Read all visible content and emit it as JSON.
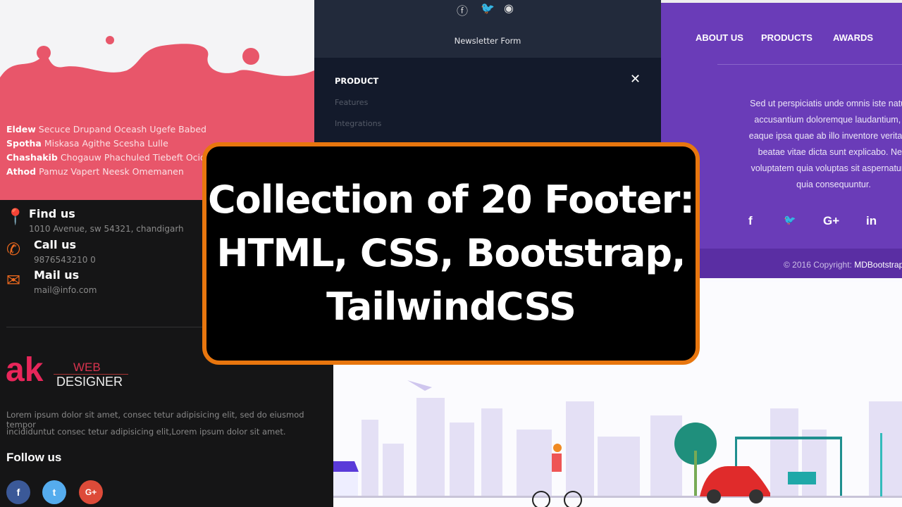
{
  "title_lines": [
    "Collection of 20 Footer:",
    "HTML, CSS, Bootstrap,",
    "TailwindCSS"
  ],
  "colors": {
    "card_border": "#e8760e",
    "pink": "#e8566a",
    "purple": "#6a3cb8",
    "accent_orange": "#f06a1e"
  },
  "pink_footer": {
    "rows": [
      {
        "head": "Eldew",
        "items": "Secuce Drupand Oceash Ugefe Babed"
      },
      {
        "head": "Spotha",
        "items": "Miskasa Agithe Scesha Lulle"
      },
      {
        "head": "Chashakib",
        "items": "Chogauw Phachuled Tiebeft Ocid Iz"
      },
      {
        "head": "Athod",
        "items": "Pamuz Vapert Neesk Omemanen"
      }
    ]
  },
  "contact": {
    "find": {
      "label": "Find us",
      "value": "1010 Avenue, sw 54321, chandigarh",
      "icon": "map-pin-icon"
    },
    "call": {
      "label": "Call us",
      "value": "9876543210 0",
      "icon": "phone-icon"
    },
    "mail": {
      "label": "Mail us",
      "value": "mail@info.com",
      "icon": "mail-icon"
    }
  },
  "brand": {
    "logo": "ak",
    "web": "WEB",
    "designer": "DESIGNER"
  },
  "about_text_1": "Lorem ipsum dolor sit amet, consec tetur adipisicing elit, sed do eiusmod tempor",
  "about_text_2": "incididuntut consec tetur adipisicing elit,Lorem ipsum dolor sit amet.",
  "follow_us": "Follow us",
  "follow_icons": [
    "facebook-icon",
    "twitter-icon",
    "google-plus-icon"
  ],
  "dark_footer": {
    "newsletter": "Newsletter Form",
    "section": "PRODUCT",
    "links": [
      "Features",
      "Integrations"
    ],
    "icons": [
      "facebook-icon",
      "twitter-icon",
      "github-icon"
    ]
  },
  "purple_footer": {
    "nav": [
      "ABOUT US",
      "PRODUCTS",
      "AWARDS"
    ],
    "paragraph": [
      "Sed ut perspiciatis unde omnis iste natus e",
      "accusantium doloremque laudantium, tot",
      "eaque ipsa quae ab illo inventore veritatis e",
      "beatae vitae dicta sunt explicabo. Nem",
      "voluptatem quia voluptas sit aspernatur au",
      "quia consequuntur."
    ],
    "social": [
      "f",
      "🐦",
      "G+",
      "in"
    ],
    "copyright": "© 2016 Copyright:",
    "copyright_brand": "MDBootstrap"
  }
}
